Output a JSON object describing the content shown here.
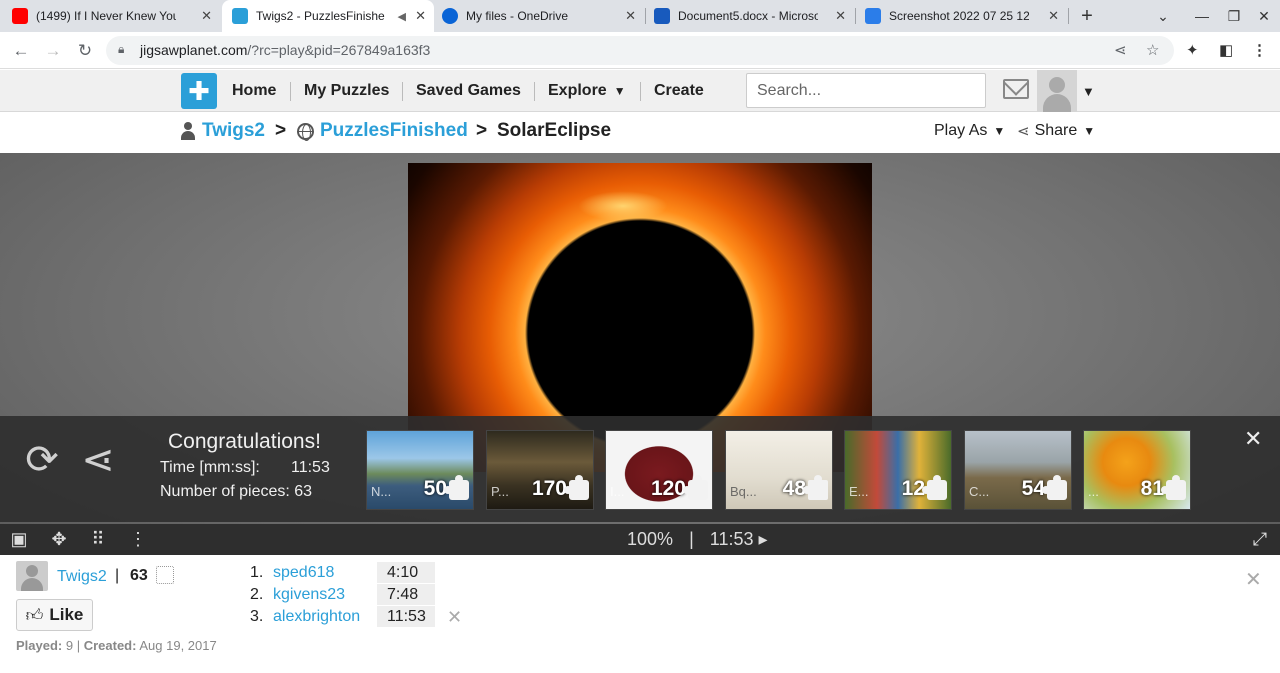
{
  "browser": {
    "tabs": [
      {
        "title": "(1499) If I Never Knew You (",
        "favicon_color": "#ff0000"
      },
      {
        "title": "Twigs2 - PuzzlesFinishe",
        "favicon_color": "#2b9fd8"
      },
      {
        "title": "My files - OneDrive",
        "favicon_color": "#0a64d6"
      },
      {
        "title": "Document5.docx - Microsof",
        "favicon_color": "#185abd"
      },
      {
        "title": "Screenshot 2022 07 25 12 3",
        "favicon_color": "#2b7de9"
      }
    ],
    "url_host": "jigsawplanet.com",
    "url_path": "/?rc=play&pid=267849a163f3"
  },
  "site": {
    "nav": [
      "Home",
      "My Puzzles",
      "Saved Games",
      "Explore",
      "Create"
    ],
    "search_placeholder": "Search...",
    "brand_color": "#2b9fd8"
  },
  "breadcrumb": {
    "user": "Twigs2",
    "folder": "PuzzlesFinished",
    "puzzle": "SolarEclipse",
    "play_as": "Play As",
    "share": "Share"
  },
  "congrats": {
    "title": "Congratulations!",
    "time_label": "Time [mm:ss]:",
    "time_value": "11:53",
    "pieces_label": "Number of pieces: 63",
    "suggestions": [
      {
        "label": "N...",
        "pieces": "50"
      },
      {
        "label": "P...",
        "pieces": "170"
      },
      {
        "label": "I...",
        "pieces": "120"
      },
      {
        "label": "Bq...",
        "pieces": "48"
      },
      {
        "label": "E...",
        "pieces": "12"
      },
      {
        "label": "C...",
        "pieces": "54"
      },
      {
        "label": "...",
        "pieces": "81"
      }
    ]
  },
  "toolbar": {
    "zoom": "100%",
    "separator": "|",
    "timer": "11:53 ▸"
  },
  "info": {
    "author": "Twigs2",
    "piece_count": "63",
    "like": "Like",
    "played_label": "Played:",
    "played_value": "9",
    "created_label": "Created:",
    "created_value": "Aug 19, 2017",
    "leaderboard": [
      {
        "rank": "1.",
        "name": "sped618",
        "time": "4:10"
      },
      {
        "rank": "2.",
        "name": "kgivens23",
        "time": "7:48"
      },
      {
        "rank": "3.",
        "name": "alexbrighton",
        "time": "11:53"
      }
    ]
  }
}
